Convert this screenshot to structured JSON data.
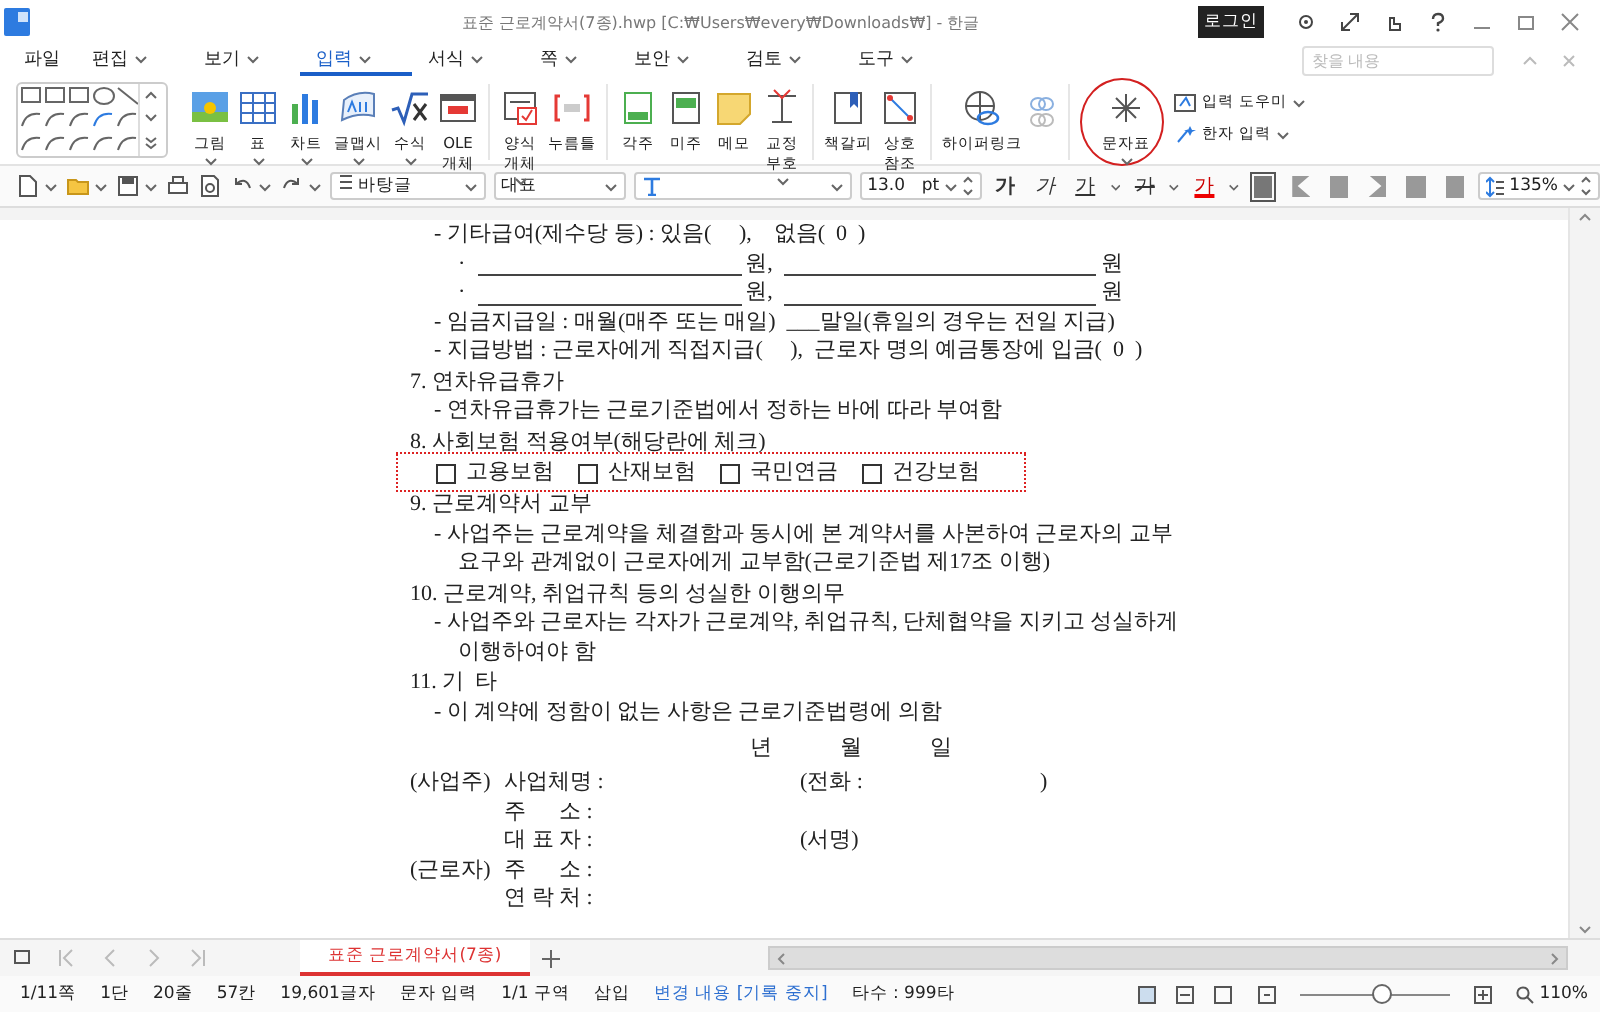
{
  "window": {
    "title": "표준 근로계약서(7종).hwp [C:₩Users₩every₩Downloads₩] - 한글",
    "login": "로그인"
  },
  "menu": [
    {
      "label": "파일",
      "selected": false,
      "dropdown": false
    },
    {
      "label": "편집",
      "selected": false,
      "dropdown": true
    },
    {
      "label": "보기",
      "selected": false,
      "dropdown": true
    },
    {
      "label": "입력",
      "selected": true,
      "dropdown": true
    },
    {
      "label": "서식",
      "selected": false,
      "dropdown": true
    },
    {
      "label": "쪽",
      "selected": false,
      "dropdown": true
    },
    {
      "label": "보안",
      "selected": false,
      "dropdown": true
    },
    {
      "label": "검토",
      "selected": false,
      "dropdown": true
    },
    {
      "label": "도구",
      "selected": false,
      "dropdown": true
    }
  ],
  "find": {
    "placeholder": "찾을 내용"
  },
  "ribbon": {
    "groups": [
      {
        "items": [
          {
            "lines": [
              "그림"
            ],
            "caret": true,
            "circled": false
          },
          {
            "lines": [
              "표"
            ],
            "caret": true,
            "circled": false
          },
          {
            "lines": [
              "차트"
            ],
            "caret": true,
            "circled": false
          },
          {
            "lines": [
              "글맵시"
            ],
            "caret": true,
            "circled": false
          },
          {
            "lines": [
              "수식"
            ],
            "caret": true,
            "circled": false
          },
          {
            "lines": [
              "OLE",
              "개체"
            ],
            "caret": false,
            "circled": false
          }
        ]
      },
      {
        "items": [
          {
            "lines": [
              "양식",
              "개체"
            ],
            "caret": true,
            "circled": false
          },
          {
            "lines": [
              "누름틀"
            ],
            "caret": false,
            "circled": false
          }
        ]
      },
      {
        "items": [
          {
            "lines": [
              "각주"
            ],
            "caret": false,
            "circled": false
          },
          {
            "lines": [
              "미주"
            ],
            "caret": false,
            "circled": false
          },
          {
            "lines": [
              "메모"
            ],
            "caret": false,
            "circled": false
          },
          {
            "lines": [
              "교정",
              "부호"
            ],
            "caret": true,
            "circled": false
          }
        ]
      },
      {
        "items": [
          {
            "lines": [
              "책갈피"
            ],
            "caret": false,
            "circled": false
          },
          {
            "lines": [
              "상호",
              "참조"
            ],
            "caret": false,
            "circled": false
          }
        ]
      },
      {
        "items": [
          {
            "lines": [
              "하이퍼링크"
            ],
            "caret": false,
            "circled": false
          }
        ]
      },
      {
        "items": [
          {
            "lines": [
              "문자표"
            ],
            "caret": true,
            "circled": true
          }
        ]
      }
    ],
    "small": [
      {
        "label": "입력 도우미",
        "caret": true
      },
      {
        "label": "한자 입력",
        "caret": true
      }
    ]
  },
  "toolbar": {
    "style": "바탕글",
    "lang": "대표",
    "size": "13.0",
    "unit": "pt",
    "format": [
      {
        "label": "가",
        "kind": "bold"
      },
      {
        "label": "가",
        "kind": "italic"
      },
      {
        "label": "가",
        "kind": "underline"
      },
      {
        "label": "가",
        "kind": "strike"
      },
      {
        "label": "가",
        "kind": "color"
      }
    ],
    "align": [
      {
        "selected": true
      },
      {
        "selected": false
      },
      {
        "selected": false
      },
      {
        "selected": false
      },
      {
        "selected": false
      },
      {
        "selected": false
      }
    ],
    "spacing": "135",
    "spacing_unit": "%"
  },
  "document": [
    {
      "kind": "item",
      "text": "- 기타급여(제수당 등) : 있음(     ),    없음(  0  )"
    },
    {
      "kind": "amount",
      "bullet": "·",
      "parts": [
        "원,",
        "원"
      ]
    },
    {
      "kind": "amount",
      "bullet": "·",
      "parts": [
        "원,",
        "원"
      ]
    },
    {
      "kind": "item",
      "text": "- 임금지급일 : 매월(매주 또는 매일)  ___말일(휴일의 경우는 전일 지급)"
    },
    {
      "kind": "item",
      "text": "- 지급방법 : 근로자에게 직접지급(     ),  근로자 명의 예금통장에 입금(  0  )"
    },
    {
      "kind": "heading",
      "text": "7. 연차유급휴가"
    },
    {
      "kind": "item",
      "text": "- 연차유급휴가는 근로기준법에서 정하는 바에 따라 부여함"
    },
    {
      "kind": "heading",
      "text": "8. 사회보험 적용여부(해당란에 체크)"
    },
    {
      "kind": "checks",
      "boxed": true,
      "items": [
        {
          "label": "고용보험",
          "checked": false
        },
        {
          "label": "산재보험",
          "checked": false
        },
        {
          "label": "국민연금",
          "checked": false
        },
        {
          "label": "건강보험",
          "checked": false
        }
      ]
    },
    {
      "kind": "heading",
      "text": "9. 근로계약서 교부"
    },
    {
      "kind": "item",
      "text": "- 사업주는 근로계약을 체결함과 동시에 본 계약서를 사본하여 근로자의 교부"
    },
    {
      "kind": "cont",
      "text": "요구와 관계없이 근로자에게 교부함(근로기준법 제17조 이행)"
    },
    {
      "kind": "heading",
      "text": "10. 근로계약, 취업규칙 등의 성실한 이행의무"
    },
    {
      "kind": "item",
      "text": "- 사업주와 근로자는 각자가 근로계약, 취업규칙, 단체협약을 지키고 성실하게"
    },
    {
      "kind": "cont",
      "text": "이행하여야 함"
    },
    {
      "kind": "heading",
      "text": "11. 기  타"
    },
    {
      "kind": "item",
      "text": "- 이 계약에 정함이 없는 사항은 근로기준법령에 의함"
    },
    {
      "kind": "date",
      "parts": [
        "년",
        "월",
        "일"
      ]
    },
    {
      "kind": "sign",
      "role": "(사업주)",
      "label": "사업체명 :",
      "note": "(전화 :",
      "close": ")"
    },
    {
      "kind": "sign",
      "label": "주      소 :"
    },
    {
      "kind": "sign",
      "label": "대 표 자 :",
      "note": "(서명)"
    },
    {
      "kind": "sign",
      "role": "(근로자)",
      "label": "주      소 :"
    },
    {
      "kind": "sign",
      "label": "연 락 처 :"
    }
  ],
  "tabs": [
    {
      "label": "표준 근로계약서(7종)",
      "selected": true
    }
  ],
  "status": {
    "items": [
      {
        "text": "1/11쪽",
        "kind": "plain"
      },
      {
        "text": "1단",
        "kind": "plain"
      },
      {
        "text": "20줄",
        "kind": "plain"
      },
      {
        "text": "57칸",
        "kind": "plain"
      },
      {
        "text": "19,601글자",
        "kind": "plain"
      },
      {
        "text": "문자 입력",
        "kind": "plain"
      },
      {
        "text": "1/1 구역",
        "kind": "plain"
      },
      {
        "text": "삽입",
        "kind": "plain"
      },
      {
        "text": "변경 내용 [기록 중지]",
        "kind": "link"
      },
      {
        "text": "타수 : 999타",
        "kind": "plain"
      }
    ],
    "zoom": {
      "level": 0.55,
      "reading": "110%"
    }
  }
}
